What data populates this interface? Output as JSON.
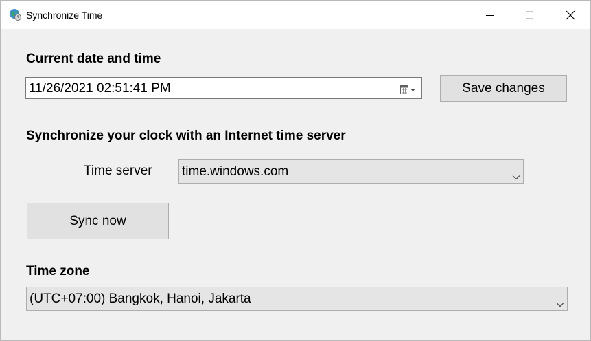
{
  "window": {
    "title": "Synchronize Time"
  },
  "date_section": {
    "heading": "Current date and time",
    "datetime_value": "11/26/2021  02:51:41 PM",
    "save_label": "Save changes"
  },
  "sync_section": {
    "heading": "Synchronize your clock with an Internet time server",
    "server_label": "Time server",
    "server_value": "time.windows.com",
    "sync_label": "Sync now"
  },
  "timezone_section": {
    "heading": "Time zone",
    "timezone_value": "(UTC+07:00) Bangkok, Hanoi, Jakarta"
  },
  "icons": {
    "app": "globe-clock-icon",
    "minimize": "minimize-icon",
    "maximize": "maximize-icon",
    "close": "close-icon",
    "calendar": "calendar-dropdown-icon",
    "dropdown": "chevron-down-icon"
  }
}
